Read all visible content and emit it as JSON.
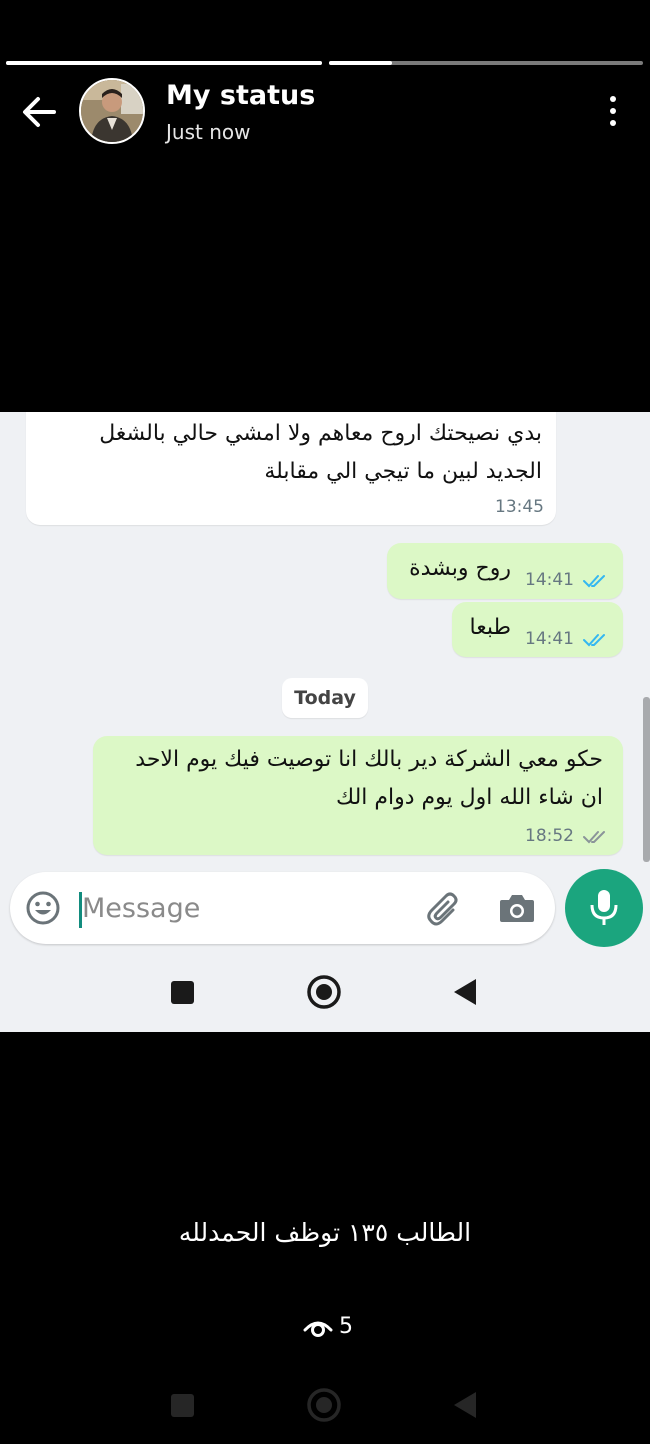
{
  "header": {
    "title": "My status",
    "subtitle": "Just now",
    "progress": [
      1.0,
      0.2
    ]
  },
  "chat": {
    "messages": [
      {
        "direction": "in",
        "lines": [
          "بدي نصيحتك اروح معاهم ولا امشي حالي بالشغل",
          "الجديد لبين ما تيجي الي مقابلة"
        ],
        "time": "13:45"
      },
      {
        "direction": "out",
        "lines": [
          "روح وبشدة"
        ],
        "time": "14:41",
        "read": true
      },
      {
        "direction": "out",
        "lines": [
          "طبعا"
        ],
        "time": "14:41",
        "read": true
      },
      {
        "direction": "out",
        "lines": [
          "حكو معي الشركة دير بالك انا توصيت فيك يوم الاحد",
          "ان شاء الله اول يوم دوام الك"
        ],
        "time": "18:52",
        "read": false
      }
    ],
    "date_divider": "Today",
    "input_placeholder": "Message"
  },
  "caption": "الطالب ١٣٥ توظف الحمدلله",
  "views": "5",
  "icons": {
    "back": "arrow-left-icon",
    "menu": "kebab-menu-icon",
    "emoji": "emoji-icon",
    "attach": "paperclip-icon",
    "camera": "camera-icon",
    "mic": "microphone-icon",
    "eye": "eye-icon"
  },
  "colors": {
    "outgoing_bubble": "#dcf8c6",
    "incoming_bubble": "#ffffff",
    "accent": "#1ba57e",
    "read_ticks": "#34b7f1"
  }
}
